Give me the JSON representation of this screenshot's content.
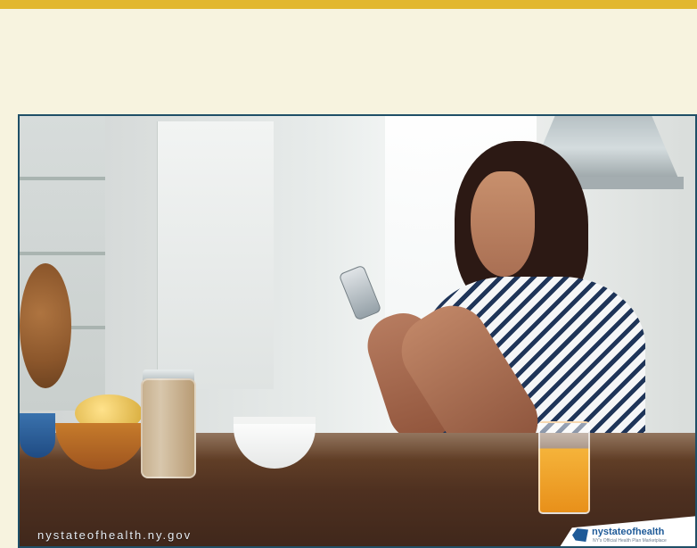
{
  "colors": {
    "page_background": "#f7f3df",
    "top_rule": "#e2b72f",
    "frame_border": "#1f4f67",
    "logo_blue": "#1e5a98",
    "logo_yellow": "#e7a300"
  },
  "hero": {
    "url_text": "nystateofhealth.ny.gov",
    "logo": {
      "primary": "nystateofhealth",
      "subtitle": "NY's Official Health Plan Marketplace"
    }
  }
}
